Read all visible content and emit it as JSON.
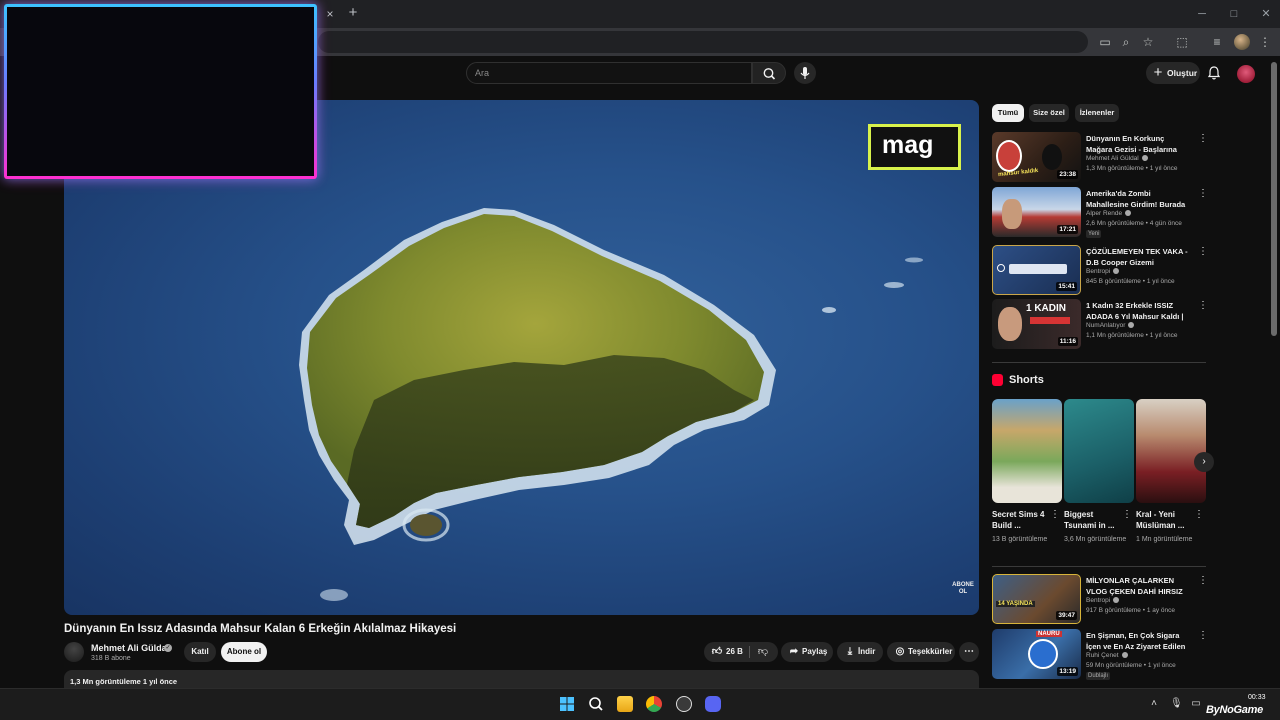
{
  "browser": {
    "close_tab": "×",
    "new_tab": "+",
    "minimize": "─",
    "maximize": "□",
    "close_window": "✕"
  },
  "header": {
    "search_placeholder": "Ara",
    "create_label": "Oluştur"
  },
  "video": {
    "overlay_badge": "mag",
    "watermark": "ABONE OL",
    "title": "Dünyanın En Issız Adasında Mahsur Kalan 6 Erkeğin Akılalmaz Hikayesi",
    "channel": "Mehmet Ali Güldal",
    "subscribers": "318 B abone",
    "join_label": "Katıl",
    "subscribe_label": "Abone ol",
    "likes": "26 B",
    "share_label": "Paylaş",
    "download_label": "İndir",
    "thanks_label": "Teşekkürler",
    "description_meta": "1,3 Mn görüntüleme  1 yıl önce"
  },
  "chips": [
    "Tümü",
    "Size özel",
    "İzlenenler"
  ],
  "recommendations": [
    {
      "title": "Dünyanın En Korkunç Mağara Gezisi - Başlarına Gelmeyen ...",
      "channel": "Mehmet Ali Güldal",
      "meta": "1,3 Mn görüntüleme • 1 yıl önce",
      "duration": "23:38",
      "thumb_text": "mahsur kaldık",
      "badge": ""
    },
    {
      "title": "Amerika'da Zombi Mahallesine Girdim! Burada Her Şey Yasal! ...",
      "channel": "Alper Rende",
      "meta": "2,6 Mn görüntüleme • 4 gün önce",
      "duration": "17:21",
      "thumb_text": "",
      "badge": "Yeni"
    },
    {
      "title": "ÇÖZÜLEMEYEN TEK VAKA - D.B Cooper Gizemi",
      "channel": "Bentropi",
      "meta": "845 B görüntüleme • 1 yıl önce",
      "duration": "15:41",
      "thumb_text": "",
      "badge": ""
    },
    {
      "title": "1 Kadın 32 Erkekle ISSIZ ADADA 6 Yıl Mahsur Kaldı | ...",
      "channel": "NumAnlatıyor",
      "meta": "1,1 Mn görüntüleme • 1 yıl önce",
      "duration": "11:16",
      "thumb_text": "1 KADIN",
      "badge": ""
    }
  ],
  "shorts": {
    "title": "Shorts",
    "items": [
      {
        "title": "Secret Sims 4 Build ...",
        "views": "13 B görüntüleme"
      },
      {
        "title": "Biggest Tsunami in ...",
        "views": "3,6 Mn görüntüleme"
      },
      {
        "title": "Kral - Yeni Müslüman ...",
        "views": "1 Mn görüntüleme"
      }
    ]
  },
  "recommendations2": [
    {
      "title": "MİLYONLAR ÇALARKEN VLOG ÇEKEN DAHİ HIRSIZ",
      "channel": "Bentropi",
      "meta": "917 B görüntüleme • 1 ay önce",
      "duration": "39:47",
      "thumb_text": "14 YAŞINDA",
      "badge": ""
    },
    {
      "title": "En Şişman, En Çok Sigara İçen ve En Az Ziyaret Edilen Ülkeye ...",
      "channel": "Ruhi Çenet",
      "meta": "59 Mn görüntüleme • 1 yıl önce",
      "duration": "13:19",
      "thumb_text": "NAURU",
      "badge": "Dublajlı"
    }
  ],
  "taskbar": {
    "time": "00:33",
    "watermark": "ByNoGame"
  },
  "colors": {
    "neon_top": "#3cc3ff",
    "neon_bottom": "#ff2fcf",
    "mag_border": "#d8f24b",
    "shorts_red": "#ff0033"
  }
}
